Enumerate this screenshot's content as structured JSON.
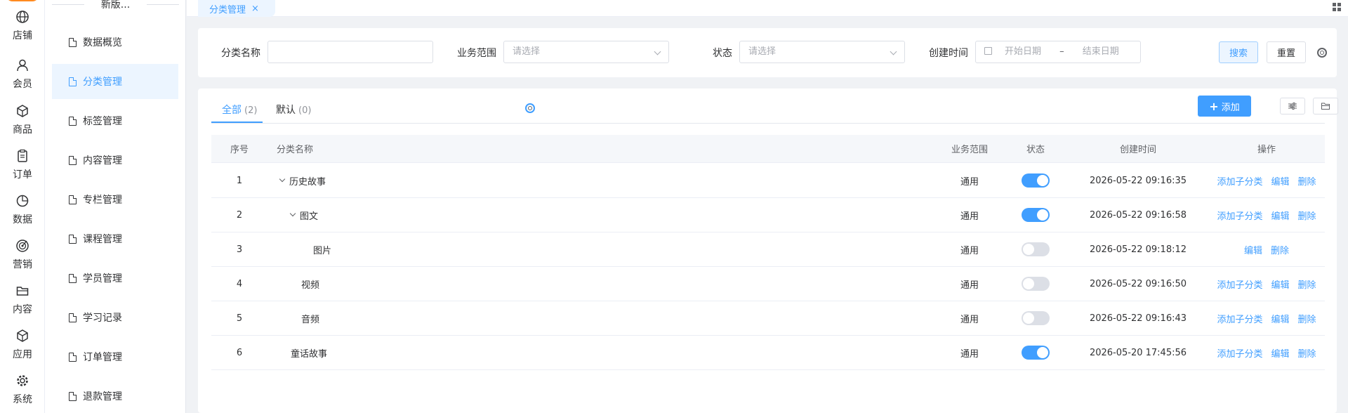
{
  "rail": {
    "items": [
      {
        "label": "店铺",
        "icon": "globe-icon"
      },
      {
        "label": "会员",
        "icon": "user-icon"
      },
      {
        "label": "商品",
        "icon": "box-icon"
      },
      {
        "label": "订单",
        "icon": "clipboard-icon"
      },
      {
        "label": "数据",
        "icon": "pie-chart-icon"
      },
      {
        "label": "营销",
        "icon": "target-icon"
      },
      {
        "label": "内容",
        "icon": "folder-icon"
      },
      {
        "label": "应用",
        "icon": "cube-icon"
      },
      {
        "label": "系统",
        "icon": "gear-icon"
      }
    ]
  },
  "submenu": {
    "title": "新版...",
    "items": [
      {
        "label": "数据概览",
        "active": false
      },
      {
        "label": "分类管理",
        "active": true
      },
      {
        "label": "标签管理",
        "active": false
      },
      {
        "label": "内容管理",
        "active": false
      },
      {
        "label": "专栏管理",
        "active": false
      },
      {
        "label": "课程管理",
        "active": false
      },
      {
        "label": "学员管理",
        "active": false
      },
      {
        "label": "学习记录",
        "active": false
      },
      {
        "label": "订单管理",
        "active": false
      },
      {
        "label": "退款管理",
        "active": false
      }
    ]
  },
  "tabbar": {
    "active_tab": "分类管理",
    "close": "×"
  },
  "search": {
    "name_label": "分类名称",
    "name_value": "",
    "scope_label": "业务范围",
    "scope_placeholder": "请选择",
    "status_label": "状态",
    "status_placeholder": "请选择",
    "created_label": "创建时间",
    "start_placeholder": "开始日期",
    "range_sep": "–",
    "end_placeholder": "结束日期",
    "search_button": "搜索",
    "reset_button": "重置"
  },
  "list": {
    "tabs": [
      {
        "label": "全部",
        "count": "(2)"
      },
      {
        "label": "默认",
        "count": "(0)"
      }
    ],
    "add_button": "添加",
    "columns": {
      "index": "序号",
      "name": "分类名称",
      "scope": "业务范围",
      "status": "状态",
      "created": "创建时间",
      "ops": "操作"
    },
    "rows": [
      {
        "index": "1",
        "name": "历史故事",
        "level": 0,
        "expandable": true,
        "scope": "通用",
        "enabled": true,
        "created": "2026-05-22 09:16:35",
        "ops": [
          "添加子分类",
          "编辑",
          "删除"
        ]
      },
      {
        "index": "2",
        "name": "图文",
        "level": 1,
        "expandable": true,
        "scope": "通用",
        "enabled": true,
        "created": "2026-05-22 09:16:58",
        "ops": [
          "添加子分类",
          "编辑",
          "删除"
        ]
      },
      {
        "index": "3",
        "name": "图片",
        "level": 2,
        "expandable": false,
        "scope": "通用",
        "enabled": false,
        "created": "2026-05-22 09:18:12",
        "ops": [
          "编辑",
          "删除"
        ]
      },
      {
        "index": "4",
        "name": "视频",
        "level": 1,
        "expandable": false,
        "scope": "通用",
        "enabled": false,
        "created": "2026-05-22 09:16:50",
        "ops": [
          "添加子分类",
          "编辑",
          "删除"
        ]
      },
      {
        "index": "5",
        "name": "音频",
        "level": 1,
        "expandable": false,
        "scope": "通用",
        "enabled": false,
        "created": "2026-05-22 09:16:43",
        "ops": [
          "添加子分类",
          "编辑",
          "删除"
        ]
      },
      {
        "index": "6",
        "name": "童话故事",
        "level": 0,
        "expandable": false,
        "scope": "通用",
        "enabled": true,
        "created": "2026-05-20 17:45:56",
        "ops": [
          "添加子分类",
          "编辑",
          "删除"
        ]
      }
    ]
  },
  "colors": {
    "primary": "#409eff",
    "active_bg": "#ecf5ff",
    "switch_off": "#dcdfe6"
  }
}
